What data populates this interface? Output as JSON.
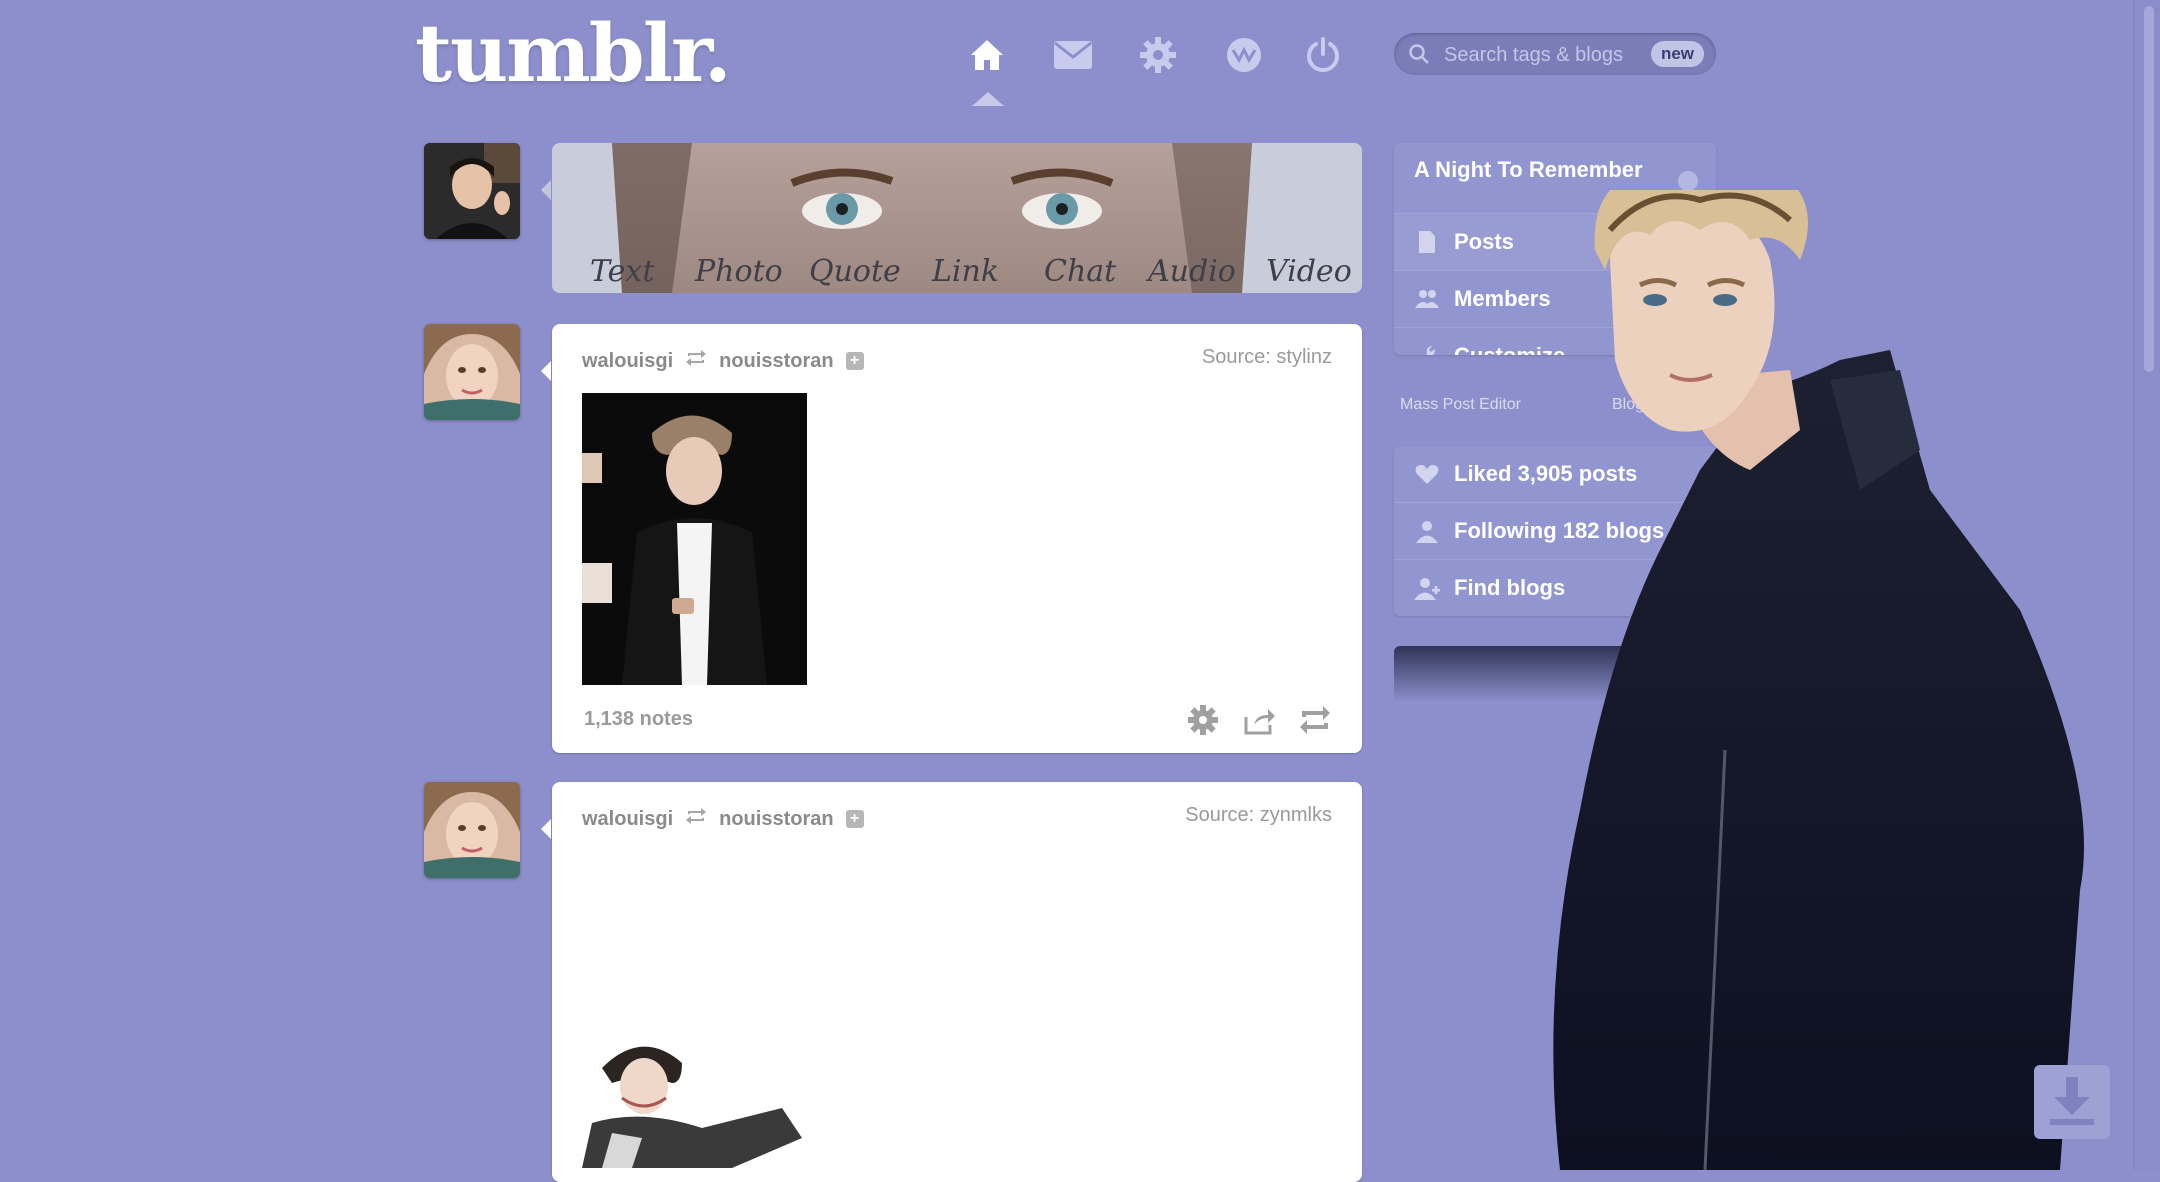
{
  "app": {
    "logo": "tumblr."
  },
  "colors": {
    "background": "#8c8fcb",
    "sidebar": "#9296d0",
    "post_bg": "#ffffff",
    "accent_text": "#3b3e72"
  },
  "nav": {
    "icons": [
      "home-icon",
      "mail-icon",
      "gear-icon",
      "activity-icon",
      "power-icon"
    ],
    "active": "home"
  },
  "search": {
    "placeholder": "Search tags & blogs",
    "badge": "new"
  },
  "post_types": [
    "Text",
    "Photo",
    "Quote",
    "Link",
    "Chat",
    "Audio",
    "Video"
  ],
  "posts": [
    {
      "author": "walouisgi",
      "reblogged_from": "nouisstoran",
      "source": "Source: stylinz",
      "notes": "1,138 notes"
    },
    {
      "author": "walouisgi",
      "reblogged_from": "nouisstoran",
      "source": "Source: zynmlks"
    }
  ],
  "sidebar": {
    "blog_title": "A Night To Remember",
    "blog_menu": [
      "Posts",
      "Members",
      "Customize"
    ],
    "mass_post_editor": "Mass Post Editor",
    "blog_settings": "Blog Settings",
    "account_menu": [
      "Liked 3,905 posts",
      "Following 182 blogs",
      "Find blogs"
    ]
  }
}
